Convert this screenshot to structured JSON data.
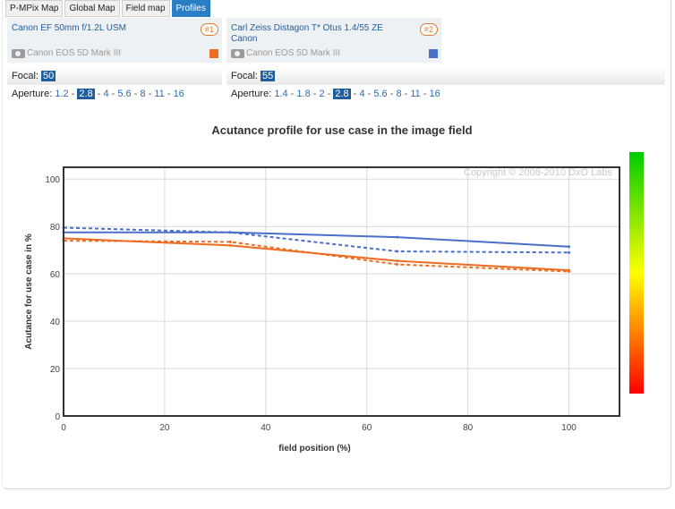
{
  "tabs": [
    {
      "label": "P-MPix Map",
      "active": false
    },
    {
      "label": "Global Map",
      "active": false
    },
    {
      "label": "Field map",
      "active": false
    },
    {
      "label": "Profiles",
      "active": true
    }
  ],
  "lenses": [
    {
      "name_line1": "Canon EF 50mm f/1.2L USM",
      "name_line2": "",
      "badge": "#1",
      "camera": "Canon EOS 5D Mark III",
      "color": "#ee6c22",
      "focal_label": "Focal:",
      "focal": "50",
      "aperture_label": "Aperture:",
      "apertures": [
        "1.2",
        "2.8",
        "4",
        "5.6",
        "8",
        "11",
        "16"
      ],
      "selected_aperture": "2.8"
    },
    {
      "name_line1": "Carl Zeiss Distagon T* Otus 1.4/55 ZE",
      "name_line2": "Canon",
      "badge": "#2",
      "camera": "Canon EOS 5D Mark III",
      "color": "#4a6fc8",
      "focal_label": "Focal:",
      "focal": "55",
      "aperture_label": "Aperture:",
      "apertures": [
        "1.4",
        "1.8",
        "2",
        "2.8",
        "4",
        "5.6",
        "8",
        "11",
        "16"
      ],
      "selected_aperture": "2.8"
    }
  ],
  "chart_data": {
    "type": "line",
    "title": "Acutance profile for use case in the image field",
    "xlabel": "field position (%)",
    "ylabel": "Acutance for use case in %",
    "xlim": [
      0,
      110
    ],
    "ylim": [
      0,
      105
    ],
    "xticks": [
      0,
      20,
      40,
      60,
      80,
      100
    ],
    "yticks": [
      0,
      20,
      40,
      60,
      80,
      100
    ],
    "copyright": "Copyright © 2008-2010 DxO Labs",
    "series": [
      {
        "color": "#4a6fc8",
        "dashed": false,
        "points": [
          [
            0,
            77.5
          ],
          [
            33,
            77.5
          ],
          [
            66,
            75.5
          ],
          [
            100,
            71.5
          ]
        ]
      },
      {
        "color": "#4a6fc8",
        "dashed": true,
        "points": [
          [
            0,
            79.5
          ],
          [
            33,
            77.5
          ],
          [
            66,
            69.5
          ],
          [
            100,
            69
          ]
        ]
      },
      {
        "color": "#ee6c22",
        "dashed": false,
        "points": [
          [
            0,
            75
          ],
          [
            33,
            72
          ],
          [
            66,
            65.5
          ],
          [
            100,
            61.5
          ]
        ]
      },
      {
        "color": "#ee6c22",
        "dashed": true,
        "points": [
          [
            0,
            74
          ],
          [
            33,
            73.5
          ],
          [
            66,
            64
          ],
          [
            100,
            61
          ]
        ]
      }
    ],
    "colorbar": {
      "colors": [
        "#00cc00",
        "#ffff00",
        "#ff0000"
      ]
    }
  }
}
